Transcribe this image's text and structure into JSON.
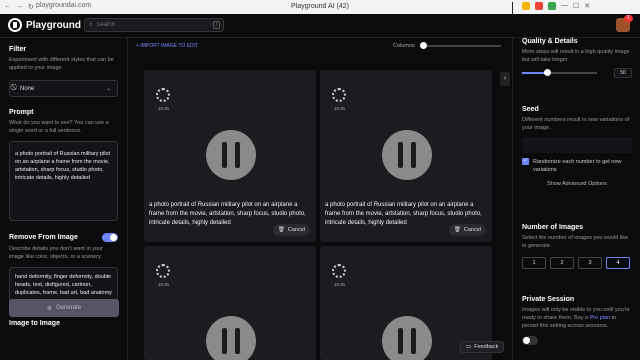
{
  "browser": {
    "url": "playgroundai.com",
    "window_title": "Playground AI (42)"
  },
  "app": {
    "name": "Playground",
    "search_placeholder": "Search",
    "search_shortcut": "/",
    "notification_count": "1"
  },
  "left_panel": {
    "filter_heading": "Filter",
    "filter_desc": "Experiment with different styles that can be applied to your image.",
    "filter_value": "None",
    "prompt_heading": "Prompt",
    "prompt_desc": "What do you want to see? You can use a single word or a full sentence.",
    "prompt_text": "a photo portrait of Russian military pilot on an airplane a frame from the movie, artstation, sharp focus, studio photo, intricate details, highly detailed",
    "remove_heading": "Remove From Image",
    "remove_desc": "Describe details you don't want in your image like color, objects, or a scenery.",
    "negative_text": "hand deformity, finger deformity, double heads, text, disfigured, cartoon, duplicates, frame, bad art, bad anatomy",
    "image_to_image_heading": "Image to Image",
    "generate_label": "Generate"
  },
  "center": {
    "import_label": "+ IMPORT IMAGE TO EDIT",
    "columns_label": "Columns",
    "cards": [
      {
        "elapsed": "10.8s",
        "caption": "a photo portrait of Russian military pilot on an airplane a frame from the movie, artstation, sharp focus, studio photo, intricate details, highly detailed",
        "cancel": "Cancel"
      },
      {
        "elapsed": "10.8s",
        "caption": "a photo portrait of Russian military pilot on an airplane a frame from the movie, artstation, sharp focus, studio photo, intricate details, highly detailed",
        "cancel": "Cancel"
      },
      {
        "elapsed": "10.8s"
      },
      {
        "elapsed": "10.8s"
      }
    ],
    "feedback_label": "Feedback"
  },
  "right_panel": {
    "quality_heading": "Quality & Details",
    "quality_desc": "More steps will result in a high quality image but will take longer.",
    "quality_value": "50",
    "quality_fraction": 0.33,
    "seed_heading": "Seed",
    "seed_desc": "Different numbers result in new variations of your image.",
    "randomize_label": "Randomize each number to get new variations",
    "advanced_label": "Show Advanced Options",
    "num_images_heading": "Number of Images",
    "num_images_desc": "Select the number of images you would like to generate.",
    "num_options": [
      "1",
      "2",
      "3",
      "4"
    ],
    "num_selected": "4",
    "private_heading": "Private Session",
    "private_desc_1": "Images will only be visible to you until you're ready to share them. Buy a ",
    "private_link": "Pro plan",
    "private_desc_2": " to persist this setting across sessions."
  }
}
